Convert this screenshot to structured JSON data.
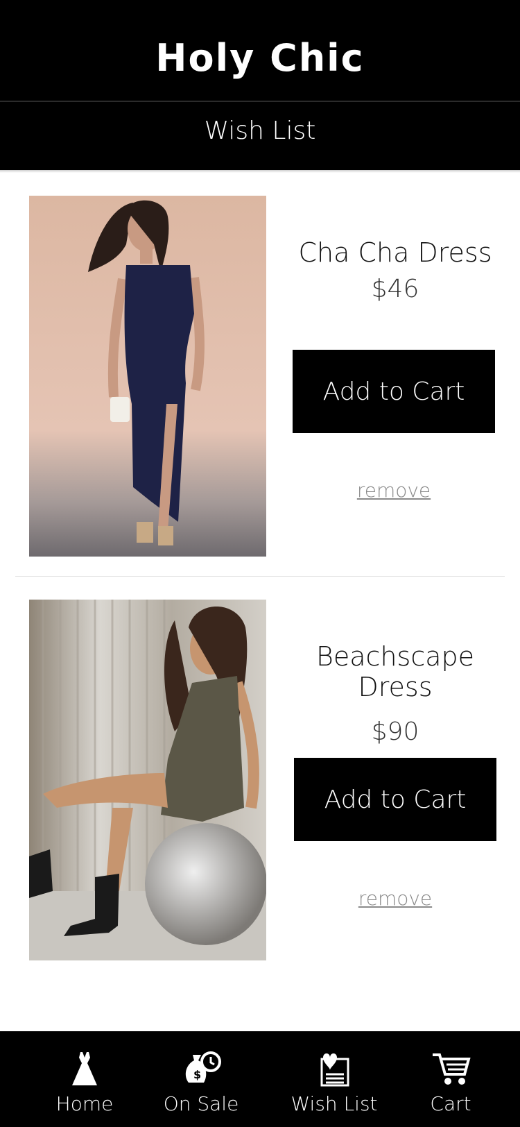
{
  "header": {
    "app_title": "Holy Chic",
    "page_title": "Wish List"
  },
  "items": [
    {
      "name": "Cha Cha Dress",
      "price": "$46",
      "add_label": "Add to Cart",
      "remove_label": "remove",
      "image": "navy wrap dress photo"
    },
    {
      "name": "Beachscape Dress",
      "price": "$90",
      "add_label": "Add to Cart",
      "remove_label": "remove",
      "image": "metallic slip dress photo"
    }
  ],
  "nav": [
    {
      "label": "Home",
      "icon": "dress-icon"
    },
    {
      "label": "On Sale",
      "icon": "money-bag-clock-icon"
    },
    {
      "label": "Wish List",
      "icon": "heart-list-icon"
    },
    {
      "label": "Cart",
      "icon": "cart-icon"
    }
  ],
  "colors": {
    "bar": "#000000",
    "text_light": "#ffffff",
    "remove_link": "#8a8a8a"
  }
}
